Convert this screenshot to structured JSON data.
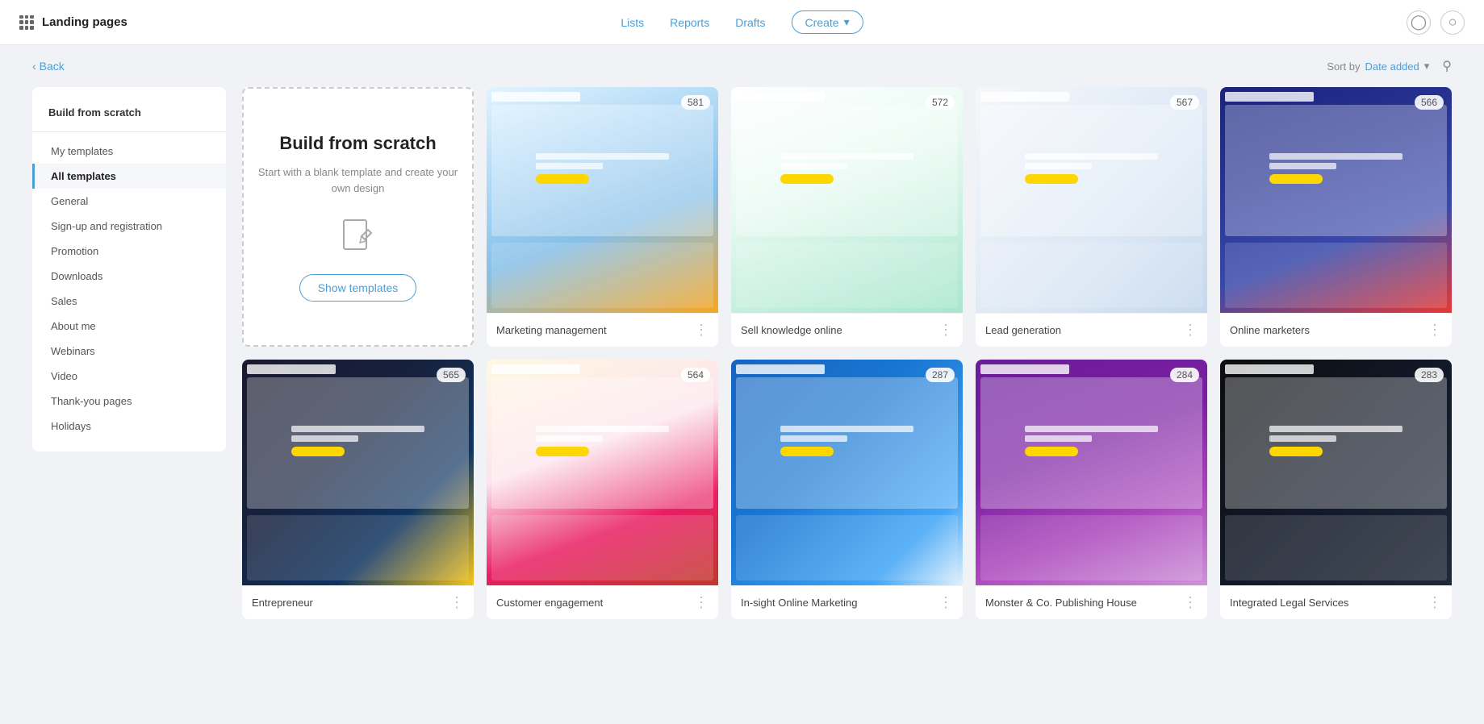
{
  "app": {
    "title": "Landing pages",
    "nav": {
      "lists": "Lists",
      "reports": "Reports",
      "drafts": "Drafts",
      "create": "Create"
    },
    "back_label": "Back",
    "sort_label": "Sort by",
    "sort_value": "Date added"
  },
  "sidebar": {
    "build_from_scratch": "Build from scratch",
    "items": [
      {
        "id": "my-templates",
        "label": "My templates",
        "active": false
      },
      {
        "id": "all-templates",
        "label": "All templates",
        "active": true
      },
      {
        "id": "general",
        "label": "General",
        "active": false
      },
      {
        "id": "sign-up",
        "label": "Sign-up and registration",
        "active": false
      },
      {
        "id": "promotion",
        "label": "Promotion",
        "active": false
      },
      {
        "id": "downloads",
        "label": "Downloads",
        "active": false
      },
      {
        "id": "sales",
        "label": "Sales",
        "active": false
      },
      {
        "id": "about-me",
        "label": "About me",
        "active": false
      },
      {
        "id": "webinars",
        "label": "Webinars",
        "active": false
      },
      {
        "id": "video",
        "label": "Video",
        "active": false
      },
      {
        "id": "thank-you",
        "label": "Thank-you pages",
        "active": false
      },
      {
        "id": "holidays",
        "label": "Holidays",
        "active": false
      }
    ]
  },
  "build_from_scratch_card": {
    "title": "Build from scratch",
    "description": "Start with a blank template and create your own design",
    "show_templates": "Show templates"
  },
  "templates": [
    {
      "id": "t1",
      "name": "Marketing management",
      "count": "581",
      "preview_class": "preview-1"
    },
    {
      "id": "t2",
      "name": "Sell knowledge online",
      "count": "572",
      "preview_class": "preview-2"
    },
    {
      "id": "t3",
      "name": "Lead generation",
      "count": "567",
      "preview_class": "preview-3"
    },
    {
      "id": "t4",
      "name": "Online marketers",
      "count": "566",
      "preview_class": "preview-4"
    },
    {
      "id": "t5",
      "name": "Entrepreneur",
      "count": "565",
      "preview_class": "preview-5"
    },
    {
      "id": "t6",
      "name": "Customer engagement",
      "count": "564",
      "preview_class": "preview-6"
    },
    {
      "id": "t7",
      "name": "In-sight Online Marketing",
      "count": "287",
      "preview_class": "preview-7"
    },
    {
      "id": "t8",
      "name": "Monster & Co. Publishing House",
      "count": "284",
      "preview_class": "preview-8"
    },
    {
      "id": "t9",
      "name": "Integrated Legal Services",
      "count": "283",
      "preview_class": "preview-9"
    }
  ]
}
